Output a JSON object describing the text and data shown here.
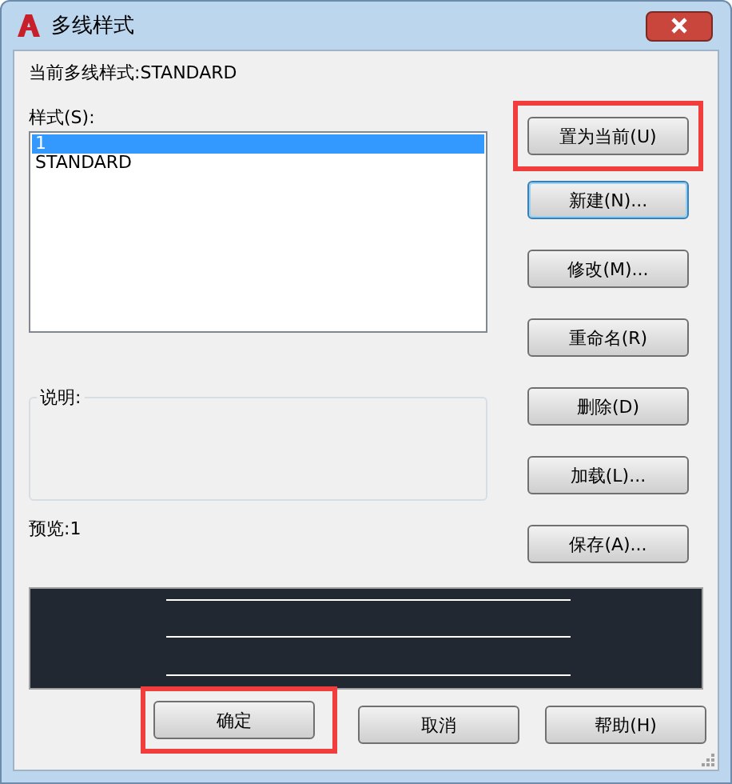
{
  "window": {
    "title": "多线样式"
  },
  "current_style": "当前多线样式:STANDARD",
  "styles_label": "样式(S):",
  "styles": [
    {
      "name": "1",
      "selected": true
    },
    {
      "name": "STANDARD",
      "selected": false
    }
  ],
  "description_label": "说明:",
  "preview_label": "预览:1",
  "side_buttons": [
    {
      "label": "置为当前(U)",
      "highlighted": true,
      "focused": false
    },
    {
      "label": "新建(N)...",
      "highlighted": false,
      "focused": true
    },
    {
      "label": "修改(M)...",
      "highlighted": false,
      "focused": false
    },
    {
      "label": "重命名(R)",
      "highlighted": false,
      "focused": false
    },
    {
      "label": "删除(D)",
      "highlighted": false,
      "focused": false
    },
    {
      "label": "加载(L)...",
      "highlighted": false,
      "focused": false
    },
    {
      "label": "保存(A)...",
      "highlighted": false,
      "focused": false
    }
  ],
  "bottom_buttons": [
    {
      "label": "确定",
      "highlighted": true,
      "focused": false
    },
    {
      "label": "取消",
      "highlighted": false,
      "focused": false
    },
    {
      "label": "帮助(H)",
      "highlighted": false,
      "focused": false
    }
  ]
}
